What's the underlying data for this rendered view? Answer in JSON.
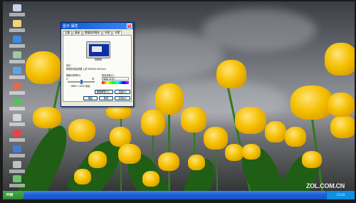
{
  "dialog": {
    "title": "显示 属性",
    "close": "×",
    "tabs": [
      "主题",
      "桌面",
      "屏幕保护程序",
      "外观",
      "设置"
    ],
    "active_tab": "设置",
    "display_label": "显示：",
    "display_value": "即插即用监视器 上的 NVIDIA GeForce",
    "resolution_label": "屏幕分辨率(S)",
    "resolution_less": "少",
    "resolution_more": "多",
    "resolution_value": "1680 x 1050 像素",
    "color_label": "颜色质量(C)",
    "color_value": "最高(32位)",
    "troubleshoot": "疑难解答(T)...",
    "advanced": "高级(V)",
    "ok": "确定",
    "cancel": "取消",
    "apply": "应用(A)"
  },
  "taskbar": {
    "start": "开始",
    "clock": "13:22"
  },
  "watermark": {
    "brand": "ZOL.COM.CN"
  },
  "desktop_icons": [
    "my-computer-icon",
    "documents-icon",
    "ie-icon",
    "recycle-bin-icon",
    "network-icon",
    "app-icon",
    "app-icon",
    "app-icon",
    "app-icon",
    "app-icon",
    "app-icon",
    "app-icon"
  ]
}
